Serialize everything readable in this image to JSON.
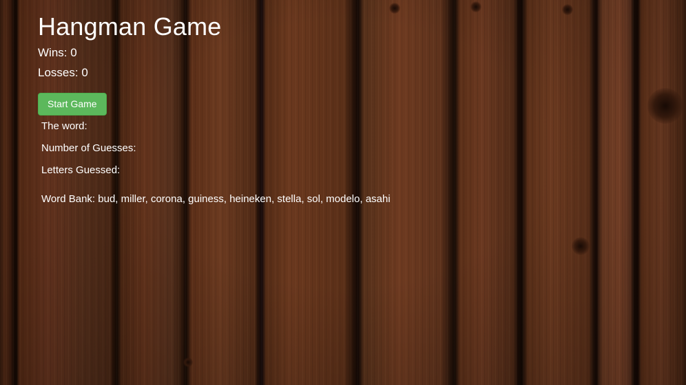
{
  "title": "Hangman Game",
  "stats": {
    "wins_label": "Wins:",
    "wins_value": "0",
    "losses_label": "Losses:",
    "losses_value": "0"
  },
  "start_button": {
    "label": "Start Game",
    "color": "#5cb85c"
  },
  "game": {
    "word_label": "The word:",
    "word_value": "",
    "guesses_label": "Number of Guesses:",
    "guesses_value": "",
    "letters_label": "Letters Guessed:",
    "letters_value": ""
  },
  "word_bank": {
    "label": "Word Bank:",
    "words": "bud, miller, corona, guiness, heineken, stella, sol, modelo, asahi"
  },
  "background": "wood-planks"
}
